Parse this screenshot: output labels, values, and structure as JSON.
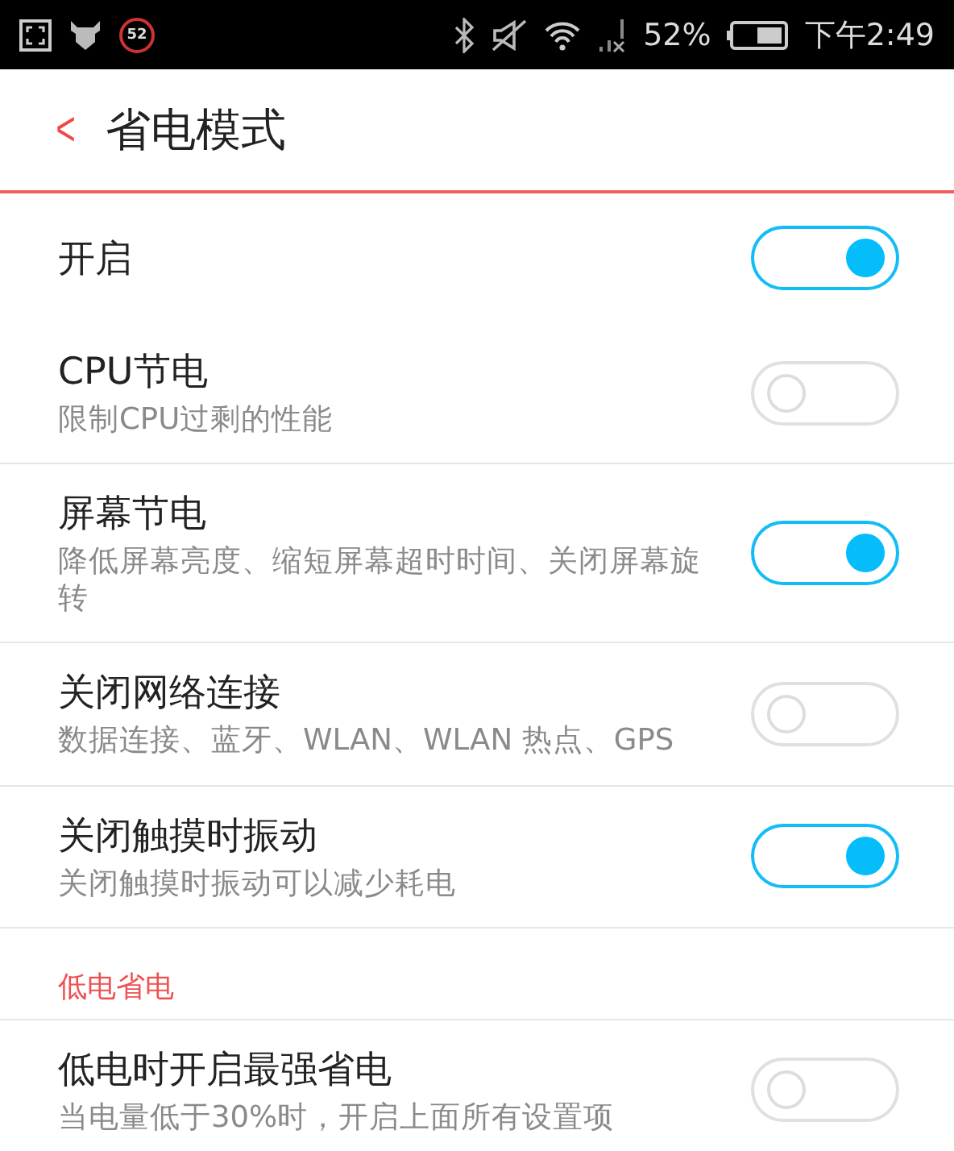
{
  "status_bar": {
    "badge": "52",
    "battery_percent": "52%",
    "time": "下午2:49"
  },
  "header": {
    "back": "<",
    "title": "省电模式"
  },
  "items": [
    {
      "title": "开启",
      "on": true
    },
    {
      "title": "CPU节电",
      "subtitle": "限制CPU过剩的性能",
      "on": false
    },
    {
      "title": "屏幕节电",
      "subtitle": "降低屏幕亮度、缩短屏幕超时时间、关闭屏幕旋转",
      "on": true
    },
    {
      "title": "关闭网络连接",
      "subtitle": "数据连接、蓝牙、WLAN、WLAN 热点、GPS",
      "on": false
    },
    {
      "title": "关闭触摸时振动",
      "subtitle": "关闭触摸时振动可以减少耗电",
      "on": true
    }
  ],
  "low_battery_section": {
    "title": "低电省电",
    "items": [
      {
        "title": "低电时开启最强省电",
        "subtitle": "当电量低于30%时，开启上面所有设置项",
        "on": false
      }
    ]
  }
}
